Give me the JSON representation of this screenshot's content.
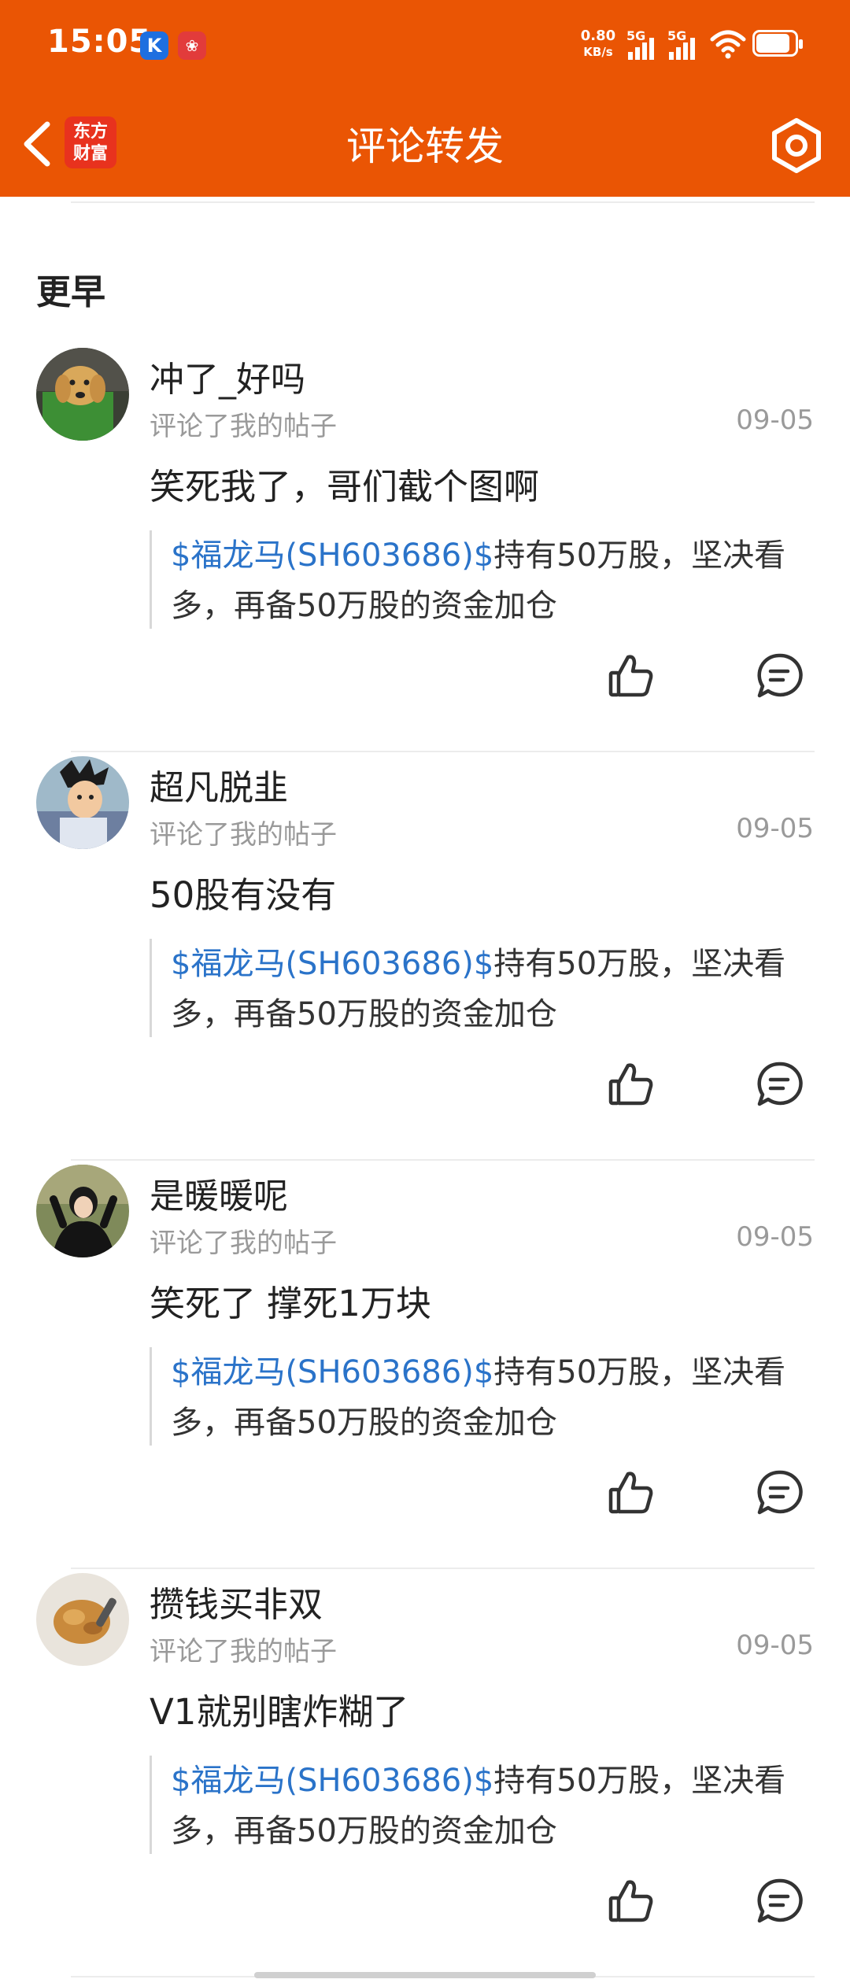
{
  "status_bar": {
    "time": "15:05",
    "app_icon_1": "K",
    "app_icon_2": "❀",
    "net_speed_value": "0.80",
    "net_speed_unit": "KB/s",
    "sim1": "5G",
    "sim2": "5G",
    "battery_level": 0.8
  },
  "header": {
    "title": "评论转发",
    "logo_line1": "东方",
    "logo_line2": "财富",
    "icons": [
      "chevron-left-icon",
      "gear-icon"
    ],
    "accent_color": "#EA5504"
  },
  "section_title": "更早",
  "items": [
    {
      "username": "冲了_好吗",
      "action": "评论了我的帖子",
      "date": "09-05",
      "comment": "笑死我了，哥们截个图啊",
      "quote_stock": "$福龙马(SH603686)$",
      "quote_rest": "持有50万股，坚决看",
      "quote_line2": "多，再备50万股的资金加仓"
    },
    {
      "username": "超凡脱韭",
      "action": "评论了我的帖子",
      "date": "09-05",
      "comment": "50股有没有",
      "quote_stock": "$福龙马(SH603686)$",
      "quote_rest": "持有50万股，坚决看",
      "quote_line2": "多，再备50万股的资金加仓"
    },
    {
      "username": "是暖暖呢",
      "action": "评论了我的帖子",
      "date": "09-05",
      "comment": "笑死了 撑死1万块",
      "quote_stock": "$福龙马(SH603686)$",
      "quote_rest": "持有50万股，坚决看",
      "quote_line2": "多，再备50万股的资金加仓"
    },
    {
      "username": "攒钱买非双",
      "action": "评论了我的帖子",
      "date": "09-05",
      "comment": "V1就别瞎炸糊了",
      "quote_stock": "$福龙马(SH603686)$",
      "quote_rest": "持有50万股，坚决看",
      "quote_line2": "多，再备50万股的资金加仓"
    }
  ],
  "colors": {
    "stock_link": "#2A73C9",
    "secondary_text": "#9a9a9a"
  }
}
